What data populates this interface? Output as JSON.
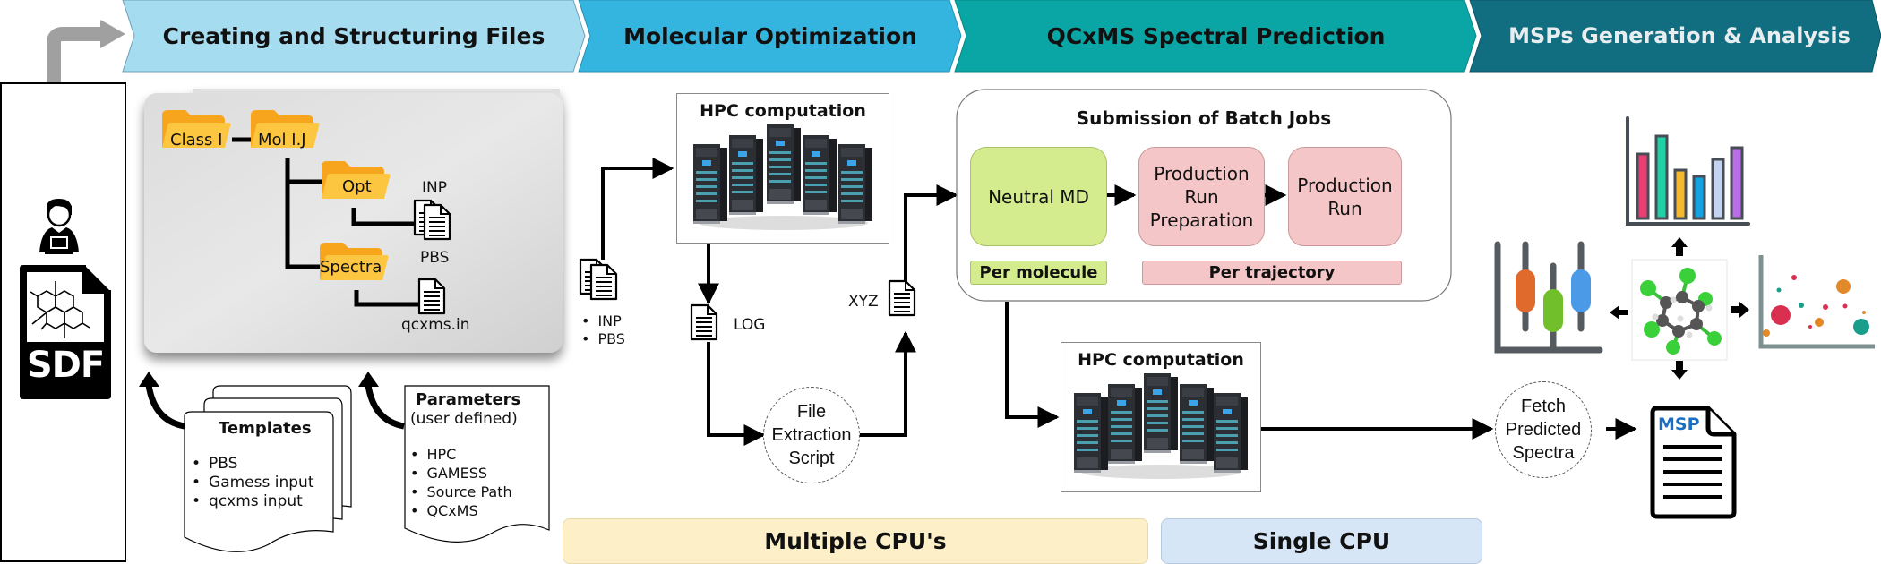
{
  "stages": [
    {
      "label": "Creating and Structuring Files",
      "color": "#a6dcf0",
      "text_color": "#0a0a0a"
    },
    {
      "label": "Molecular Optimization",
      "color": "#33b5e0",
      "text_color": "#0a0a0a"
    },
    {
      "label": "QCxMS Spectral Prediction",
      "color": "#0aa5a5",
      "text_color": "#0a0a0a"
    },
    {
      "label": "MSPs Generation & Analysis",
      "color": "#116d80",
      "text_color": "#e8eef0"
    }
  ],
  "input": {
    "user_icon": "user-laptop-icon",
    "file_icon": "sdf-file-icon",
    "file_label": "SDF"
  },
  "folder_tree": {
    "root": "Class I",
    "molecule": "Mol I.J",
    "opt": "Opt",
    "spectra": "Spectra",
    "opt_files_top": "INP",
    "opt_files_bottom": "PBS",
    "spectra_file": "qcxms.in"
  },
  "templates": {
    "title": "Templates",
    "items": [
      "PBS",
      "Gamess input",
      "qcxms input"
    ]
  },
  "parameters": {
    "title": "Parameters",
    "subtitle": "(user defined)",
    "items": [
      "HPC",
      "GAMESS",
      "Source Path",
      "QCxMS"
    ]
  },
  "optimization": {
    "hpc_title": "HPC computation",
    "inputs": [
      "INP",
      "PBS"
    ],
    "log_label": "LOG",
    "xyz_label": "XYZ",
    "script_lines": [
      "File",
      "Extraction",
      "Script"
    ]
  },
  "batch": {
    "title": "Submission of Batch Jobs",
    "neutral_md": "Neutral MD",
    "prep_lines": [
      "Production",
      "Run",
      "Preparation"
    ],
    "run_lines": [
      "Production",
      "Run"
    ],
    "per_molecule": "Per molecule",
    "per_trajectory": "Per trajectory",
    "green": "#d4ec8e",
    "pink": "#f5c6c8"
  },
  "hpc2": {
    "title": "HPC computation"
  },
  "fetch": {
    "lines": [
      "Fetch",
      "Predicted",
      "Spectra"
    ]
  },
  "msp": {
    "label": "MSP",
    "color": "#1a6fc4"
  },
  "analysis": {
    "bar_colors": [
      "#e83e74",
      "#1fd1a4",
      "#f5b82e",
      "#14a3e0",
      "#c4d4f0",
      "#b96ee8"
    ],
    "box_colors": [
      "#e06a2c",
      "#72bf2c",
      "#4a9ae8"
    ],
    "bubble_colors": [
      "#d93050",
      "#e28a2a",
      "#1a9e8c"
    ]
  },
  "resources": {
    "multiple": "Multiple CPU's",
    "single": "Single CPU",
    "multiple_color": "#fdf0c9",
    "single_color": "#d6e6f7"
  }
}
